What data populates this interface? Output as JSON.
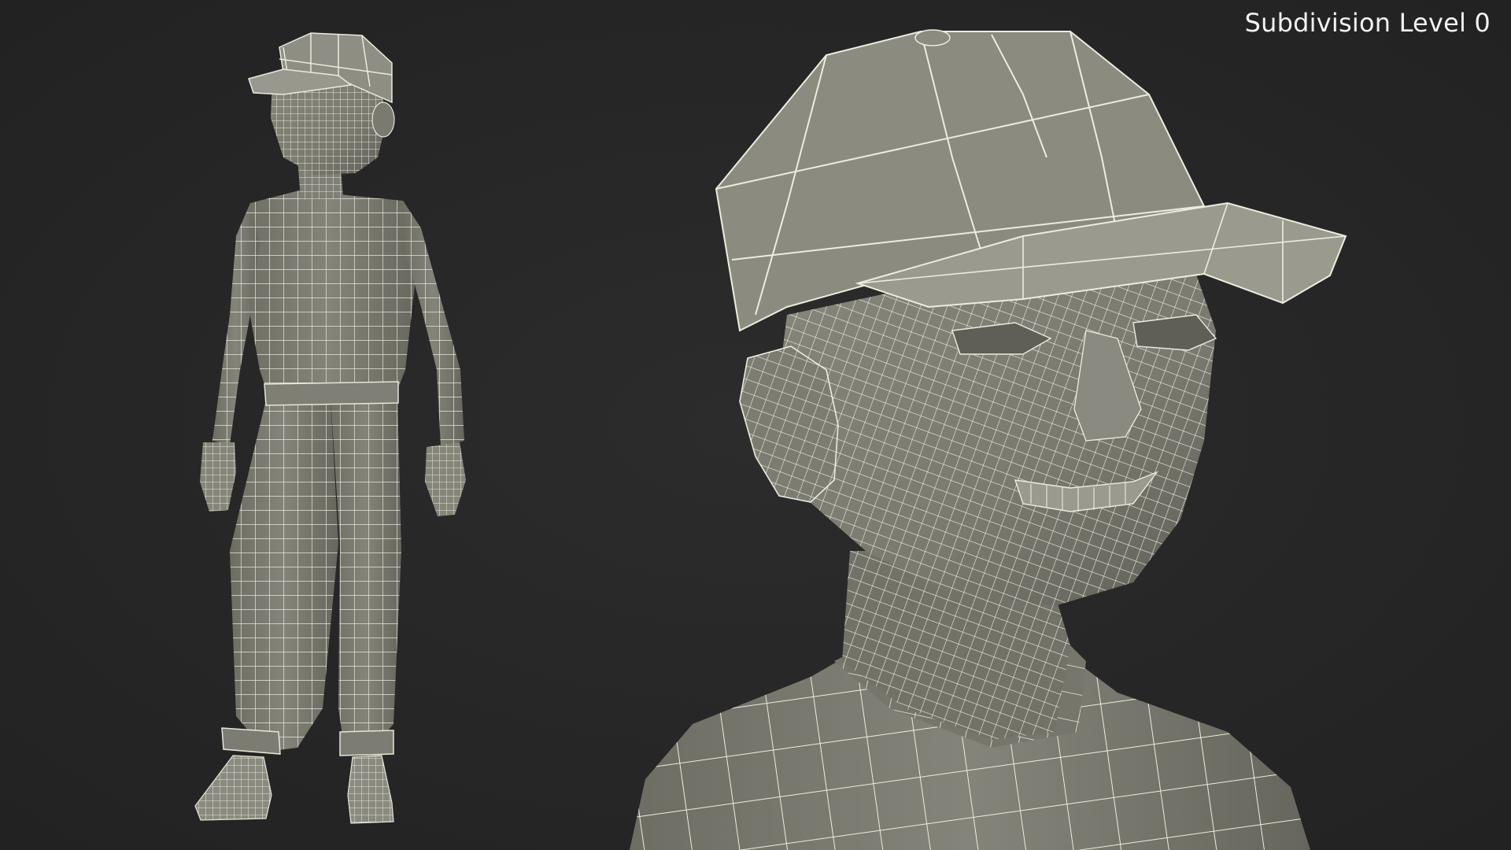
{
  "scene": {
    "caption": "Subdivision Level 0",
    "background_color": "#262626",
    "mesh_fill_color": "#7b7b70",
    "wire_color": "#e8e8dc",
    "views": [
      {
        "name": "full-body-view",
        "icon": "wireframe-boy-full-body"
      },
      {
        "name": "head-closeup-view",
        "icon": "wireframe-boy-head-closeup"
      }
    ]
  }
}
